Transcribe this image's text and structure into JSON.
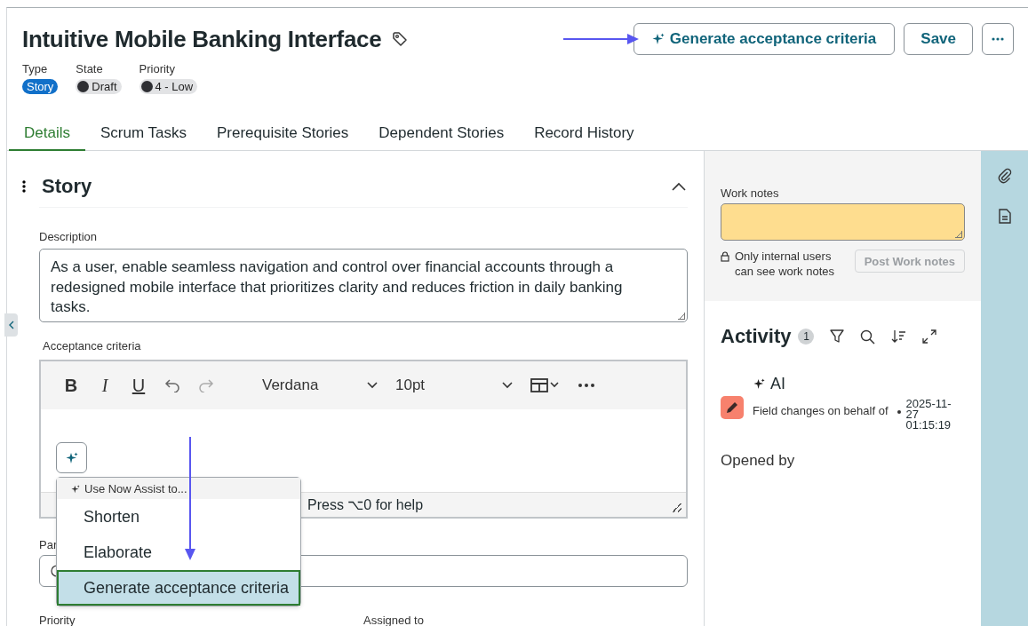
{
  "header": {
    "title": "Intuitive Mobile Banking Interface",
    "actions": [
      {
        "kind": "ai",
        "label": "Generate acceptance criteria"
      },
      {
        "kind": "plain",
        "label": "Save"
      },
      {
        "kind": "more"
      }
    ]
  },
  "fields": [
    {
      "label": "Type",
      "value": "Story",
      "kind": "badge"
    },
    {
      "label": "State",
      "value": "Draft",
      "kind": "dot"
    },
    {
      "label": "Priority",
      "value": "4 - Low",
      "kind": "dot"
    }
  ],
  "tabs": [
    {
      "label": "Details",
      "selected": true
    },
    {
      "label": "Scrum Tasks",
      "selected": false
    },
    {
      "label": "Prerequisite Stories",
      "selected": false
    },
    {
      "label": "Dependent Stories",
      "selected": false
    },
    {
      "label": "Record History",
      "selected": false
    }
  ],
  "section": {
    "title": "Story",
    "expanded": true
  },
  "description": {
    "label": "Description",
    "value": "As a user, enable seamless navigation and control over financial accounts through a redesigned mobile interface that prioritizes clarity and reduces friction in daily banking tasks."
  },
  "acceptance_criteria": {
    "label": "Acceptance criteria",
    "format_buttons": [
      {
        "kind": "bold",
        "label": "B"
      },
      {
        "kind": "italic",
        "label": "I"
      },
      {
        "kind": "underline",
        "label": "U"
      }
    ],
    "font": "Verdana",
    "size": "10pt",
    "help": "Press ⌥0 for help"
  },
  "assist_menu": {
    "heading": "Use Now Assist to...",
    "items": [
      {
        "label": "Shorten",
        "selected": false
      },
      {
        "label": "Elaborate",
        "selected": false
      },
      {
        "label": "Generate acceptance criteria",
        "selected": true
      }
    ]
  },
  "parent": {
    "label": "Par"
  },
  "bottom_labels": [
    "Priority",
    "Assigned to"
  ],
  "work_notes": {
    "label": "Work notes",
    "note": "Only internal users can see work notes",
    "button": "Post Work notes",
    "disabled": true
  },
  "activity": {
    "title": "Activity",
    "count": "1",
    "entries": [
      {
        "author": "AI",
        "text": "Field changes on behalf of",
        "time": "2025-11-27 01:15:19"
      }
    ],
    "opened_by": "Opened by"
  }
}
